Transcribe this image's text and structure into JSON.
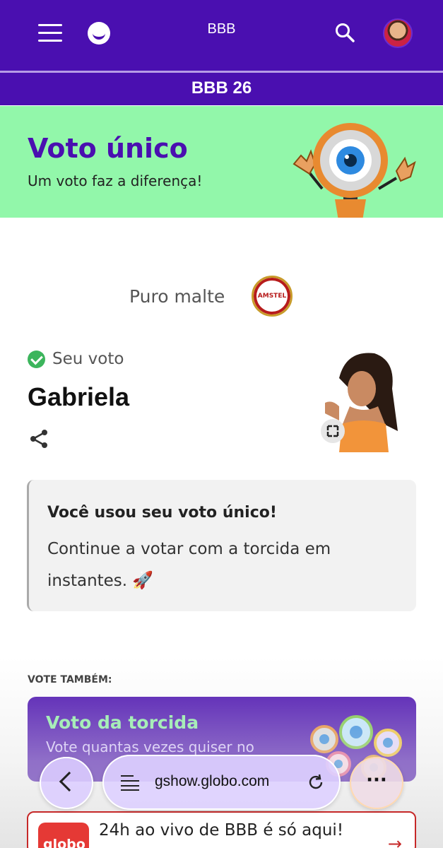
{
  "header": {
    "title": "BBB",
    "subtitle": "BBB 26",
    "menu_icon": "hamburger-menu-icon",
    "logo_icon": "smile-logo-icon",
    "search_icon": "search-icon"
  },
  "banner": {
    "title": "Voto único",
    "subtitle": "Um voto faz a diferença!",
    "background": "#92f7aa",
    "title_color": "#4a0fb0"
  },
  "sponsor": {
    "text": "Puro malte",
    "logo_text": "AMSTEL"
  },
  "vote": {
    "label": "Seu voto",
    "name": "Gabriela",
    "check_color": "#3cb55c"
  },
  "info": {
    "title": "Você usou seu voto único!",
    "text": "Continue a votar com a torcida em instantes.",
    "emoji": "🚀"
  },
  "also": {
    "label": "VOTE TAMBÉM:",
    "card_title": "Voto da torcida",
    "card_subtitle": "Vote quantas vezes quiser no"
  },
  "promo": {
    "badge": "globo",
    "text": "24h ao vivo de BBB é só aqui!"
  },
  "browser": {
    "url": "gshow.globo.com",
    "more": "···"
  },
  "colors": {
    "primary": "#4a0fb0",
    "accent_green": "#92f7aa",
    "promo_red": "#e53935"
  }
}
